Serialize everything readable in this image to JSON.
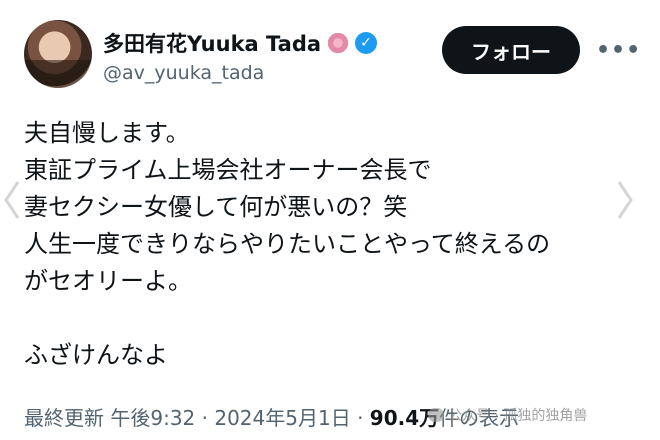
{
  "profile": {
    "display_name": "多田有花Yuuka Tada",
    "handle": "@av_yuuka_tada",
    "verified": true
  },
  "actions": {
    "follow_label": "フォロー",
    "more_label": "•••"
  },
  "tweet": {
    "lines": [
      "夫自慢します。",
      "東証プライム上場会社オーナー会長で",
      "妻セクシー女優して何が悪いの？笑",
      "人生一度できりならやりたいことやって終えるの",
      "がセオリーよ。"
    ],
    "closing": "ふざけんなよ"
  },
  "meta": {
    "updated_label": "最終更新",
    "time": "午後9:32",
    "date": "2024年5月1日",
    "separator": "·",
    "views_count": "90.4万",
    "views_label": "件の表示"
  },
  "watermark": {
    "text": "公众号 · 孤独的独角兽"
  },
  "colors": {
    "follow_bg": "#0f1419",
    "verified": "#1d9bf0",
    "secondary_text": "#536471"
  }
}
